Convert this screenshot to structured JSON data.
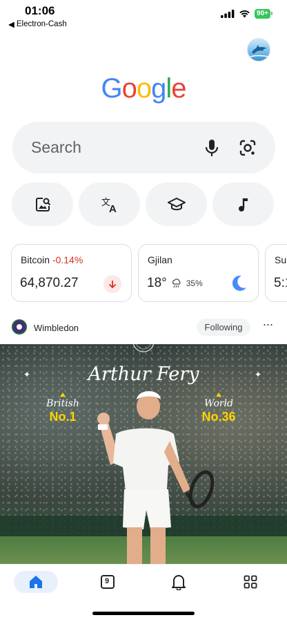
{
  "status_bar": {
    "time": "01:06",
    "back_app": "Electron-Cash",
    "battery": "90+"
  },
  "logo": {
    "text": "Google",
    "letters": [
      {
        "char": "G",
        "color": "#4285F4"
      },
      {
        "char": "o",
        "color": "#EA4335"
      },
      {
        "char": "o",
        "color": "#FBBC05"
      },
      {
        "char": "g",
        "color": "#4285F4"
      },
      {
        "char": "l",
        "color": "#34A853"
      },
      {
        "char": "e",
        "color": "#EA4335"
      }
    ]
  },
  "search": {
    "placeholder": "Search",
    "icons": [
      "mic-icon",
      "lens-icon"
    ]
  },
  "shortcuts": [
    {
      "icon": "image-search-icon"
    },
    {
      "icon": "translate-icon"
    },
    {
      "icon": "education-icon"
    },
    {
      "icon": "music-note-icon"
    }
  ],
  "cards": {
    "bitcoin": {
      "title": "Bitcoin",
      "change": "-0.14%",
      "value": "64,870.27",
      "trend": "down",
      "change_color": "#d93025"
    },
    "weather": {
      "title": "Gjilan",
      "temp": "18°",
      "precip": "35%",
      "condition": "night-rain"
    },
    "partial": {
      "title": "Sur",
      "value": "5:1"
    }
  },
  "feed": {
    "source": "Wimbledon",
    "follow_label": "Following",
    "more_label": "···",
    "hero": {
      "player": "Arthur Fery",
      "left_label": "British",
      "left_value": "No.1",
      "right_label": "World",
      "right_value": "No.36"
    }
  },
  "bottom_nav": {
    "items": [
      {
        "id": "home",
        "icon": "home-icon",
        "active": true
      },
      {
        "id": "tabs",
        "icon": "tabs-icon",
        "label": "9"
      },
      {
        "id": "notifications",
        "icon": "bell-icon"
      },
      {
        "id": "apps",
        "icon": "apps-grid-icon"
      }
    ]
  },
  "colors": {
    "accent": "#1a73e8",
    "negative": "#d93025",
    "highlight": "#ffd400"
  }
}
